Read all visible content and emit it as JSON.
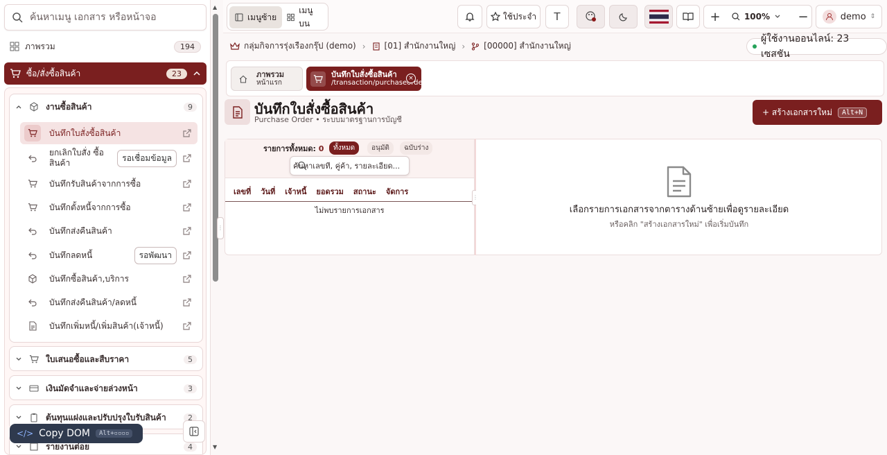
{
  "sidebar": {
    "search_placeholder": "ค้นหาเมนู เอกสาร หรือหน้าจอ",
    "overview": {
      "label": "ภาพรวม",
      "count": "194"
    },
    "active_group": {
      "label": "ซื้อ/สั่งซื้อสินค้า",
      "count": "23"
    },
    "purchase_work": {
      "label": "งานซื้อสินค้า",
      "count": "9",
      "items": [
        {
          "label": "บันทึกใบสั่งซื้อสินค้า",
          "icon": "cart-icon"
        },
        {
          "label": "ยกเลิกใบสั่ง ซื้อสินค้า",
          "icon": "undo-icon",
          "tag": "รอเชื่อมข้อมูล"
        },
        {
          "label": "บันทึกรับสินค้าจากการซื้อ",
          "icon": "cart-icon"
        },
        {
          "label": "บันทึกตั้งหนี้จากการซื้อ",
          "icon": "cart-icon"
        },
        {
          "label": "บันทึกส่งคืนสินค้า",
          "icon": "undo-icon"
        },
        {
          "label": "บันทึกลดหนี้",
          "icon": "undo-icon",
          "tag": "รอพัฒนา"
        },
        {
          "label": "บันทึกซื้อสินค้า,บริการ",
          "icon": "box-icon"
        },
        {
          "label": "บันทึกส่งคืนสินค้า/ลดหนี้",
          "icon": "undo-icon"
        },
        {
          "label": "บันทึกเพิ่มหนี้/เพิ่มสินค้า(เจ้าหนี้)",
          "icon": "document-icon"
        }
      ]
    },
    "other_groups": [
      {
        "label": "ใบเสนอซื้อและสืบราคา",
        "count": "5",
        "icon": "cart-icon"
      },
      {
        "label": "เงินมัดจำและจ่ายล่วงหน้า",
        "count": "3",
        "icon": "card-icon"
      },
      {
        "label": "ต้นทุนแฝงและปรับปรุงใบรับสินค้า",
        "count": "2",
        "icon": "clipboard-icon"
      },
      {
        "label": "รายงานต่อย",
        "count": "4",
        "icon": "report-icon"
      }
    ],
    "copy_dom": {
      "label": "Copy DOM",
      "shortcut": "Alt+▫▫▫▫"
    }
  },
  "topbar": {
    "mode_left": "เมนูซ้าย",
    "mode_top": "เมนูบน",
    "favorites": "ใช้ประจำ",
    "text_size": "T",
    "zoom": "100%",
    "user": "demo"
  },
  "breadcrumb": {
    "company": "กลุ่มกิจการรุ่งเรืองกรุ๊ป (demo)",
    "branch": "[01] สำนักงานใหญ่",
    "office": "[00000] สำนักงานใหญ่"
  },
  "online": "ผู้ใช้งานออนไลน์: 23 เซสชัน",
  "tabs": [
    {
      "title": "ภาพรวม",
      "sub": "หน้าแรก"
    },
    {
      "title": "บันทึกใบสั่งซื้อสินค้า",
      "sub": "/transaction/purchaseorder"
    }
  ],
  "page": {
    "title": "บันทึกใบสั่งซื้อสินค้า",
    "subtitle": "Purchase Order • ระบบมาตรฐานการบัญชี",
    "create_label": "+ สร้างเอกสารใหม่",
    "create_shortcut": "Alt+N"
  },
  "list": {
    "count_label": "รายการทั้งหมด:",
    "count": "0",
    "filters": [
      "ทั้งหมด",
      "อนุมัติ",
      "ฉบับร่าง"
    ],
    "search_placeholder": "ค้นหาเลขที่, คู่ค้า, รายละเอียด...",
    "columns": [
      "เลขที่",
      "วันที่",
      "เจ้าหนี้",
      "ยอดรวม",
      "สถานะ",
      "จัดการ"
    ],
    "empty": "ไม่พบรายการเอกสาร"
  },
  "detail": {
    "message": "เลือกรายการเอกสารจากตารางด้านซ้ายเพื่อดูรายละเอียด",
    "hint": "หรือคลิก \"สร้างเอกสารใหม่\" เพื่อเริ่มบันทึก"
  },
  "colors": {
    "accent": "#7a1f1f",
    "online_dot": "#25a35a",
    "copy_dom_bg": "#2f3a4e"
  }
}
